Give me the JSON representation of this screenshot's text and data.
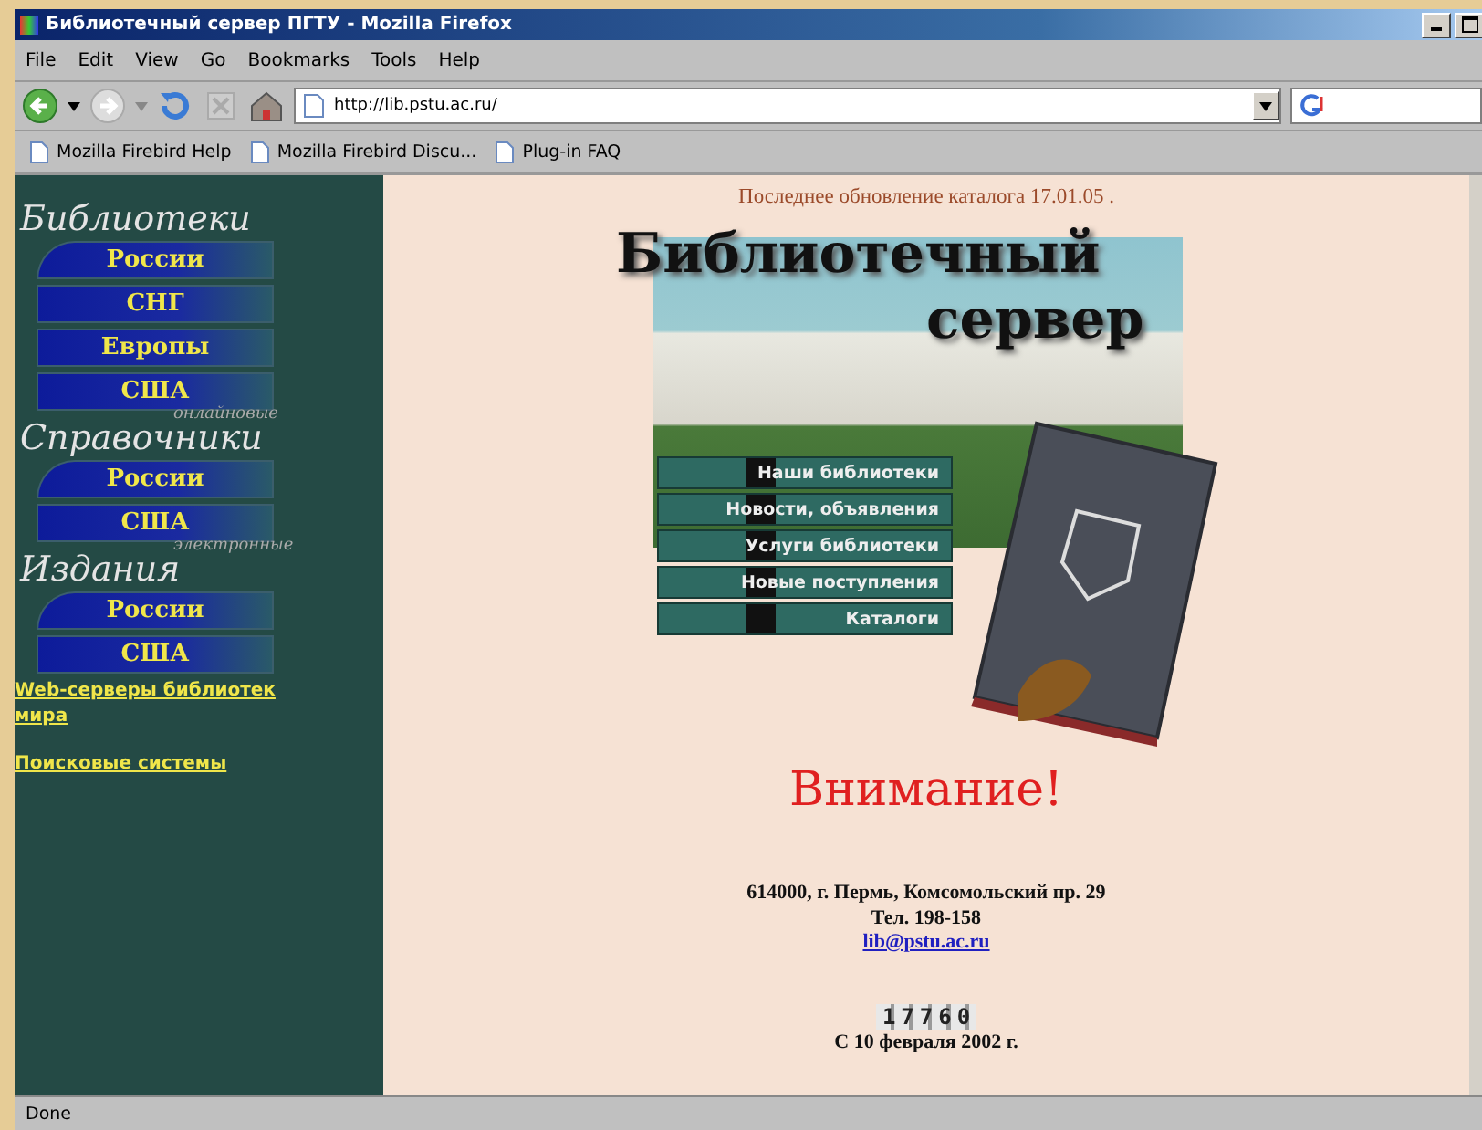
{
  "window": {
    "title": "Библиотечный сервер ПГТУ - Mozilla Firefox"
  },
  "menu": [
    "File",
    "Edit",
    "View",
    "Go",
    "Bookmarks",
    "Tools",
    "Help"
  ],
  "address": {
    "value": "http://lib.pstu.ac.ru/"
  },
  "bookmarks": [
    "Mozilla Firebird Help",
    "Mozilla Firebird Discu...",
    "Plug-in FAQ"
  ],
  "sidebar": {
    "sections": [
      {
        "title": "Библиотеки",
        "buttons": [
          "России",
          "СНГ",
          "Европы",
          "США"
        ]
      },
      {
        "title": "Справочники",
        "note": "онлайновые",
        "buttons": [
          "России",
          "США"
        ]
      },
      {
        "title": "Издания",
        "note": "электронные",
        "buttons": [
          "России",
          "США"
        ]
      }
    ],
    "links": [
      "Web-серверы библиотек мира",
      "Поисковые системы"
    ]
  },
  "page": {
    "update": "Последнее обновление каталога 17.01.05 .",
    "banner": {
      "title": "Библиотечный",
      "subtitle": "сервер",
      "spines": [
        "Наши библиотеки",
        "Новости, объявления",
        "Услуги библиотеки",
        "Новые поступления",
        "Каталоги"
      ]
    },
    "attention": "Внимание!",
    "address": "614000, г.  Пермь, Комсомольский пр. 29",
    "phone": "Тел. 198-158",
    "email": "lib@pstu.ac.ru",
    "counter": "17760",
    "since": "С 10 февраля 2002 г."
  },
  "status_bar": "Done"
}
